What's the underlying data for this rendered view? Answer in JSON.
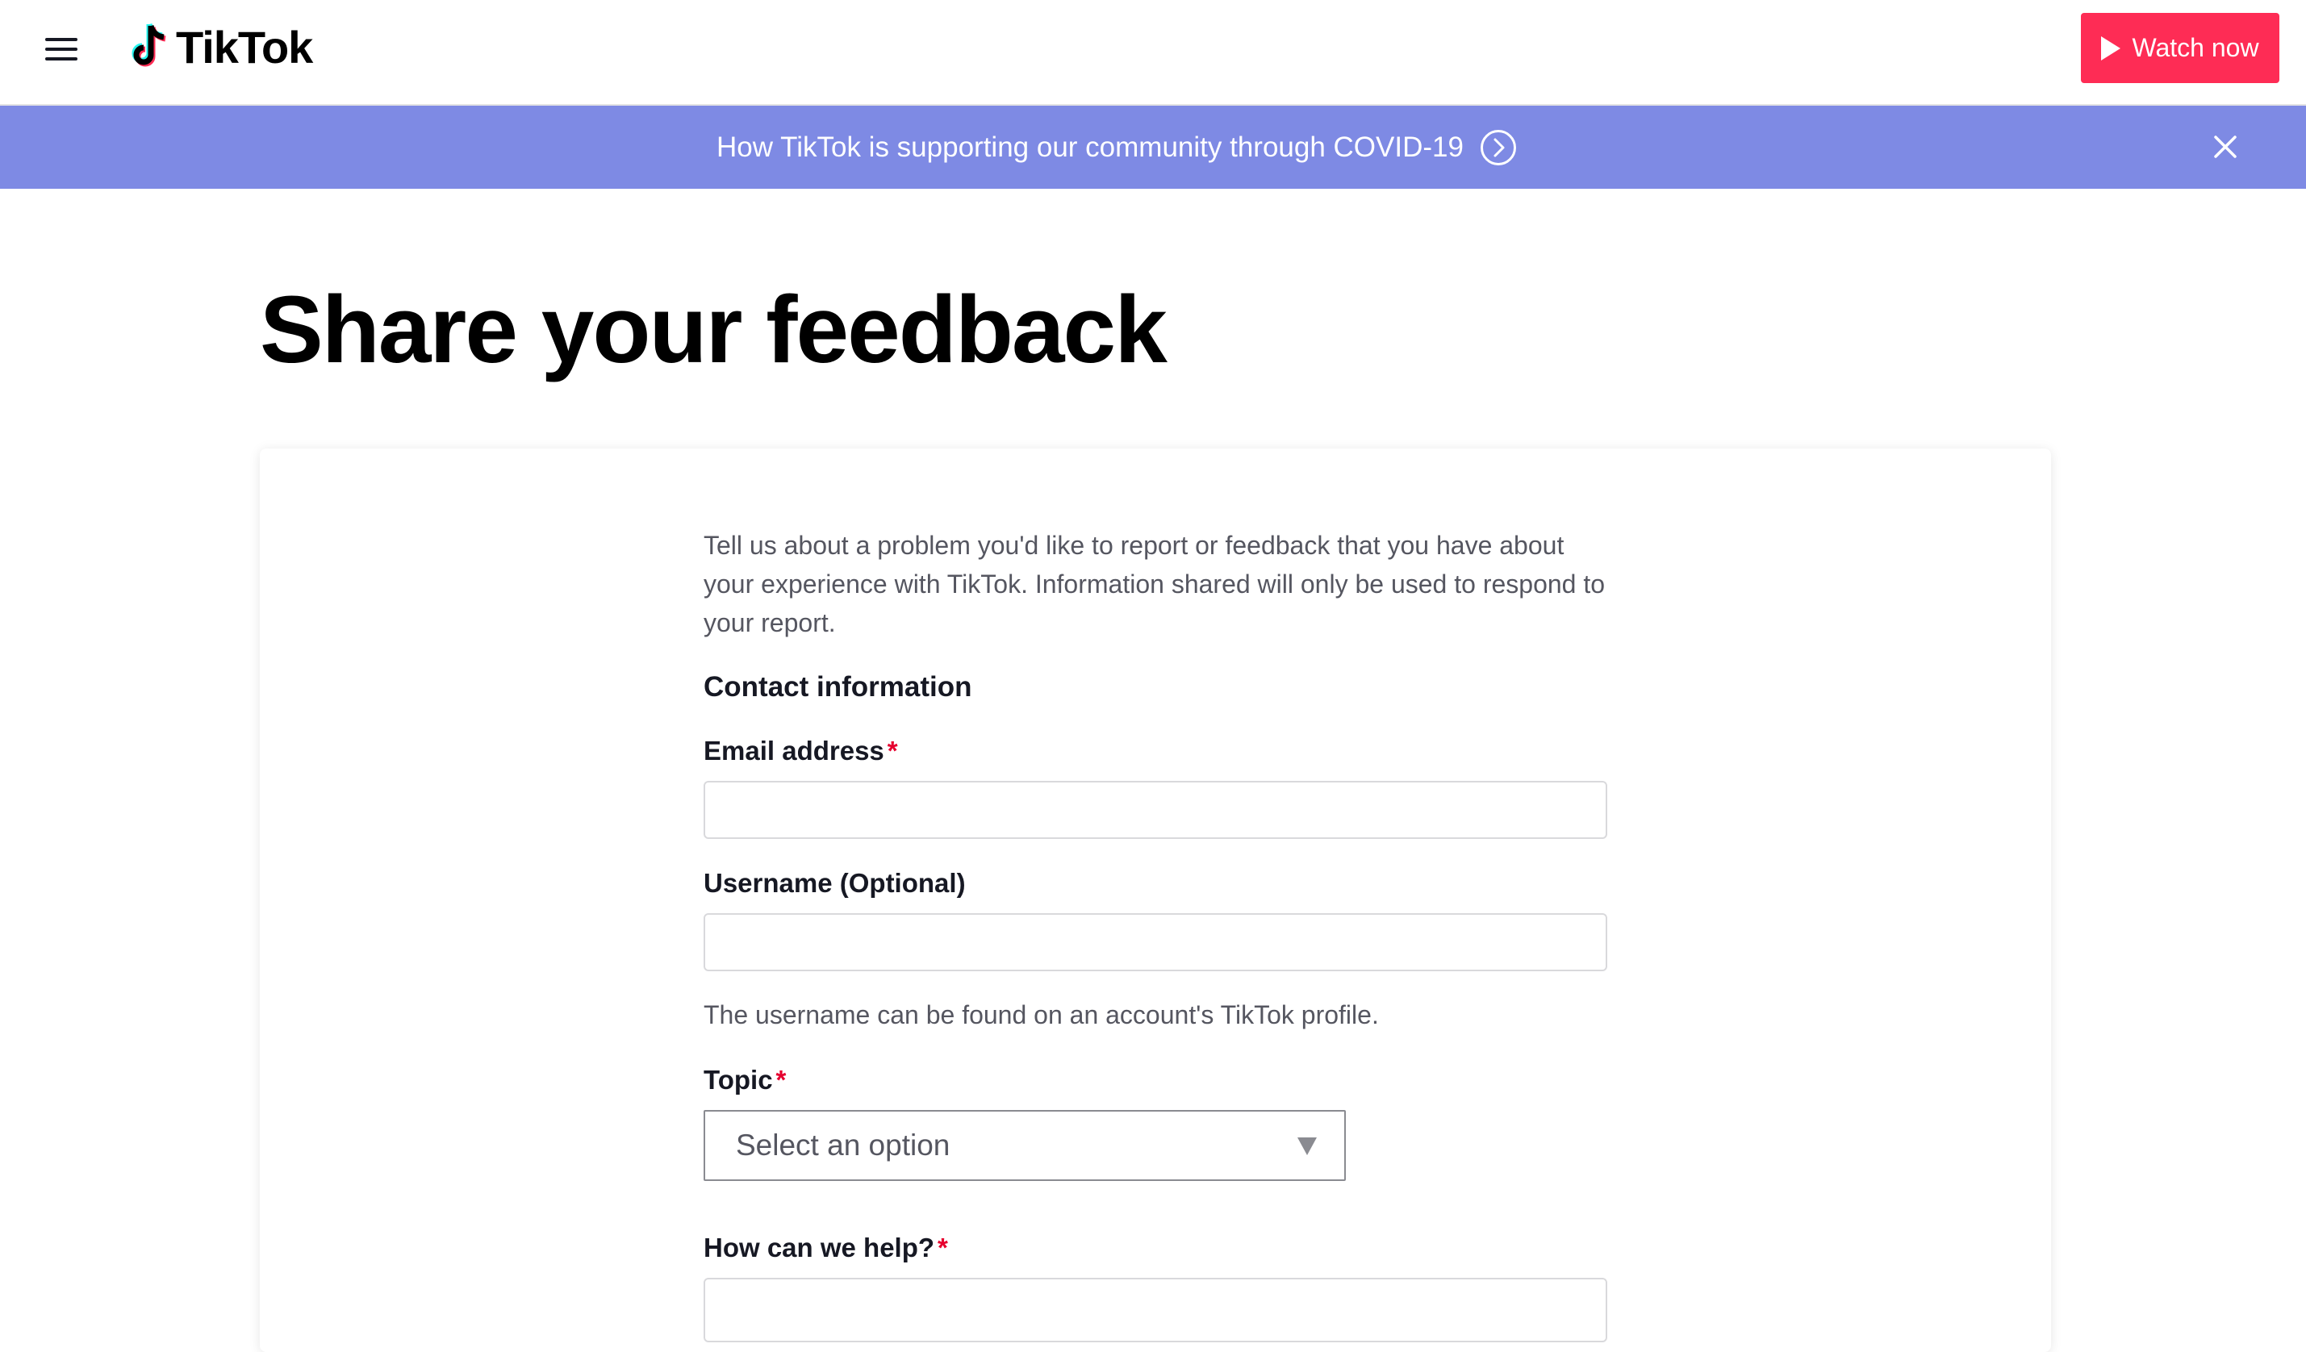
{
  "header": {
    "logo_text": "TikTok",
    "watch_label": "Watch now"
  },
  "banner": {
    "text": "How TikTok is supporting our community through COVID-19"
  },
  "page": {
    "title": "Share your feedback"
  },
  "form": {
    "intro": "Tell us about a problem you'd like to report or feedback that you have about your experience with TikTok. Information shared will only be used to respond to your report.",
    "section_title": "Contact information",
    "email_label": "Email address",
    "email_value": "",
    "username_label": "Username (Optional)",
    "username_value": "",
    "username_hint": "The username can be found on an account's TikTok profile.",
    "topic_label": "Topic",
    "topic_selected": "Select an option",
    "help_label": "How can we help?",
    "required_mark": "*"
  },
  "colors": {
    "brand_red": "#fe2c55",
    "banner_bg": "#7e8ae4",
    "required": "#e6002e"
  }
}
